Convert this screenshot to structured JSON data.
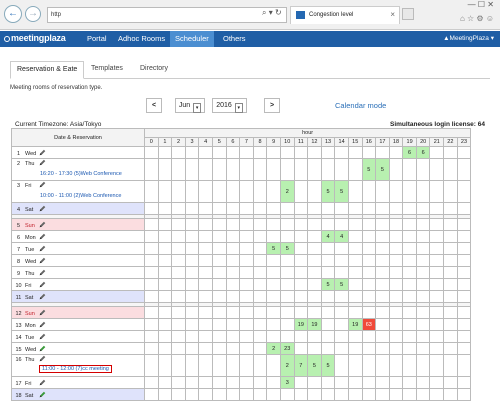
{
  "browser": {
    "address": "http",
    "tab_title": "Congestion level",
    "tab_close": "×",
    "window_controls": "— ☐ ✕",
    "toolbar_icons": "⌂ ☆ ⚙ ☺",
    "address_icons": "⌕ ▾ ↻"
  },
  "app": {
    "logo": "meetingplaza",
    "menu": [
      "Portal",
      "Adhoc Rooms",
      "Scheduler",
      "Others"
    ],
    "active_menu": "Scheduler",
    "user": "▲MeetingPlaza ▾"
  },
  "tabs": [
    "Reservation & Eate",
    "Templates",
    "Directory"
  ],
  "subtitle": "Meeting rooms of reservation type.",
  "date_controls": {
    "prev": "<",
    "next": ">",
    "month": "Jun",
    "year": "2016",
    "calendar_mode": "Calendar mode"
  },
  "timezone": "Current Timezone: Asia/Tokyo",
  "license": "Simultaneous login license: 64",
  "grid": {
    "header_hour": "hour",
    "header_date": "Date & Reservation",
    "hours": [
      "0",
      "1",
      "2",
      "3",
      "4",
      "5",
      "6",
      "7",
      "8",
      "9",
      "10",
      "11",
      "12",
      "13",
      "14",
      "15",
      "16",
      "17",
      "18",
      "19",
      "20",
      "21",
      "22",
      "23"
    ],
    "weeks": [
      [
        {
          "day": "1",
          "dow": "Wed",
          "type": "",
          "cells": {
            "19": "6",
            "20": "6"
          }
        },
        {
          "day": "2",
          "dow": "Thu",
          "type": "",
          "event": "16:20 - 17:30 (5)Web Conference",
          "cells": {
            "16": "5",
            "17": "5"
          }
        },
        {
          "day": "3",
          "dow": "Fri",
          "type": "",
          "event": "10:00 - 11:00 (2)Web Conference",
          "cells": {
            "10": "2",
            "13": "5",
            "14": "5"
          }
        },
        {
          "day": "4",
          "dow": "Sat",
          "type": "sat",
          "cells": {}
        }
      ],
      [
        {
          "day": "5",
          "dow": "Sun",
          "type": "sun",
          "cells": {}
        },
        {
          "day": "6",
          "dow": "Mon",
          "type": "",
          "cells": {
            "13": "4",
            "14": "4"
          }
        },
        {
          "day": "7",
          "dow": "Tue",
          "type": "",
          "cells": {
            "9": "5",
            "10": "5"
          }
        },
        {
          "day": "8",
          "dow": "Wed",
          "type": "",
          "cells": {}
        },
        {
          "day": "9",
          "dow": "Thu",
          "type": "",
          "cells": {}
        },
        {
          "day": "10",
          "dow": "Fri",
          "type": "",
          "cells": {
            "13": "5",
            "14": "5"
          }
        },
        {
          "day": "11",
          "dow": "Sat",
          "type": "sat",
          "cells": {}
        }
      ],
      [
        {
          "day": "12",
          "dow": "Sun",
          "type": "sun",
          "cells": {}
        },
        {
          "day": "13",
          "dow": "Mon",
          "type": "",
          "cells": {
            "11": "19",
            "12": "19",
            "15": "19",
            "16": "63"
          }
        },
        {
          "day": "14",
          "dow": "Tue",
          "type": "",
          "cells": {}
        },
        {
          "day": "15",
          "dow": "Wed",
          "type": "",
          "cells": {
            "9": "2",
            "10": "23"
          }
        },
        {
          "day": "16",
          "dow": "Thu",
          "type": "",
          "event": "11:00 - 12:00 (7)cc meeting",
          "highlight": true,
          "cells": {
            "10": "2",
            "11": "7",
            "12": "5",
            "13": "5"
          }
        },
        {
          "day": "17",
          "dow": "Fri",
          "type": "",
          "cells": {
            "10": "3"
          }
        },
        {
          "day": "18",
          "dow": "Sat",
          "type": "sat",
          "cells": {}
        }
      ]
    ],
    "red_cells": [
      "13-16"
    ]
  },
  "colors": {
    "appbar": "#1f5ea5",
    "active_menu": "#4b8ed1",
    "occupied": "#b8f0b0",
    "congested": "#f04a3a",
    "saturday": "#dfe3fb",
    "sunday": "#fbdde0",
    "highlight_border": "#d40000"
  },
  "icons": {
    "pencil": "pencil-icon",
    "back": "back-arrow-icon",
    "forward": "forward-arrow-icon"
  }
}
